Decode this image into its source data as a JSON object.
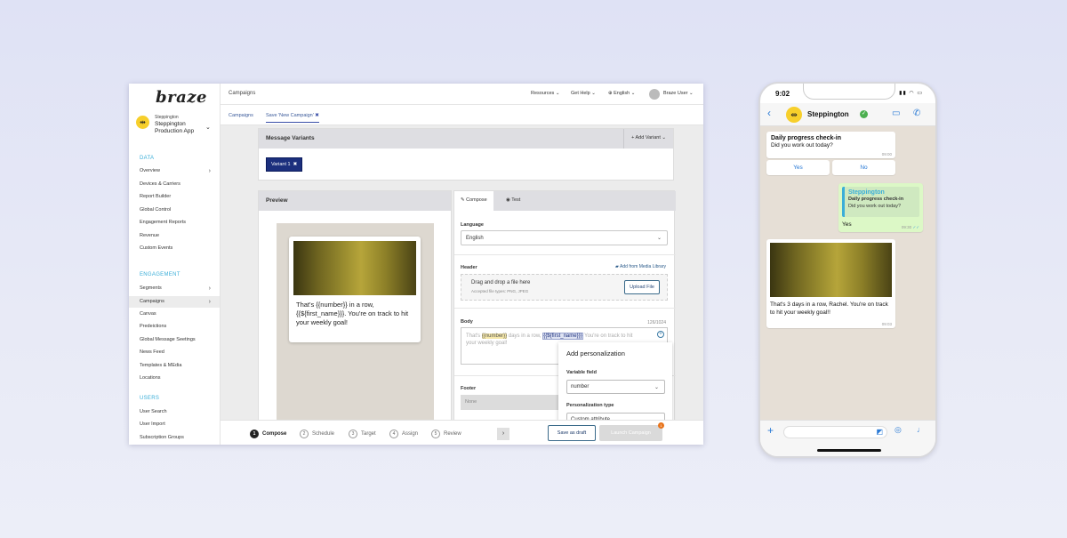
{
  "app": {
    "logo": "braze",
    "org": {
      "sub": "Steppington",
      "name": "Steppington Production App"
    },
    "sections": {
      "data": "DATA",
      "engagement": "ENGAGEMENT",
      "users": "USERS"
    },
    "nav_data": [
      "Overview",
      "Devices & Carriers",
      "Report Builder",
      "Global Control",
      "Engagement Reports",
      "Revenue",
      "Custom Events"
    ],
    "nav_engagement": [
      "Segments",
      "Campaigns",
      "Canvas",
      "Predeictions",
      "Global Message Seetings",
      "News Feed",
      "Templates & MEdia",
      "Locations"
    ],
    "nav_users": [
      "User Search",
      "User Import",
      "Subscription Groups"
    ],
    "topbar": {
      "breadcrumb": "Campaigns",
      "resources": "Resources",
      "help": "Get Help",
      "language": "English",
      "user": "Braze User"
    },
    "tabs": {
      "campaigns": "Campaigns",
      "current": "Save 'New Campaign'"
    },
    "message_variants": {
      "title": "Message Variants",
      "add_variant": "Add Variant",
      "variant_label": "Variant 1"
    },
    "preview": {
      "title": "Preview",
      "message": "That's {{number}} in a row, {{${first_name}}}. You're on track to hit your weekly goal!"
    },
    "compose": {
      "tab_compose": "Compose",
      "tab_test": "Test",
      "language_label": "Language",
      "language_value": "English",
      "header_label": "Header",
      "media_library": "Add from Media Library",
      "drop_title": "Drag and drop a file here",
      "drop_sub": "Accepted file types: PNG, JPEG",
      "upload": "Upload File",
      "body_label": "Body",
      "body_count": "126/1024",
      "body_pre": "That's ",
      "body_token1": "{{number}}",
      "body_mid": " days in a row, ",
      "body_token2": "{{${first_name}}}",
      "body_post": " You're on track to hit your weekly goal!",
      "footer_label": "Footer",
      "footer_value": "None"
    },
    "personalization": {
      "title": "Add personalization",
      "variable_label": "Variable field",
      "variable_value": "number",
      "type_label": "Personalization type",
      "type_value": "Custom attribute"
    },
    "steps": [
      {
        "num": "1",
        "label": "Compose"
      },
      {
        "num": "2",
        "label": "Schedule"
      },
      {
        "num": "3",
        "label": "Target"
      },
      {
        "num": "4",
        "label": "Assign"
      },
      {
        "num": "5",
        "label": "Review"
      }
    ],
    "buttons": {
      "draft": "Save as draft",
      "launch": "Launch Campaign",
      "launch_badge": "1"
    }
  },
  "phone": {
    "time": "9:02",
    "contact": "Steppington",
    "msg1": {
      "title": "Daily progress check-in",
      "text": "Did you work out today?",
      "time": "09:00"
    },
    "quick_replies": [
      "Yes",
      "No"
    ],
    "reply": {
      "quote_name": "Steppington",
      "quote_title": "Daily progress check-in",
      "quote_text": "Did you work out today?",
      "text": "Yes",
      "time": "09:30"
    },
    "msg2": {
      "text": "That's 3 days in a row, Rachel. You're on track to hit your weekly goal!!",
      "time": "09:03"
    }
  },
  "colors": {
    "accent": "#1c2f7d",
    "section": "#3aaed8",
    "brand_yellow": "#f7cf2b",
    "whatsapp_out": "#dcf8c6"
  }
}
